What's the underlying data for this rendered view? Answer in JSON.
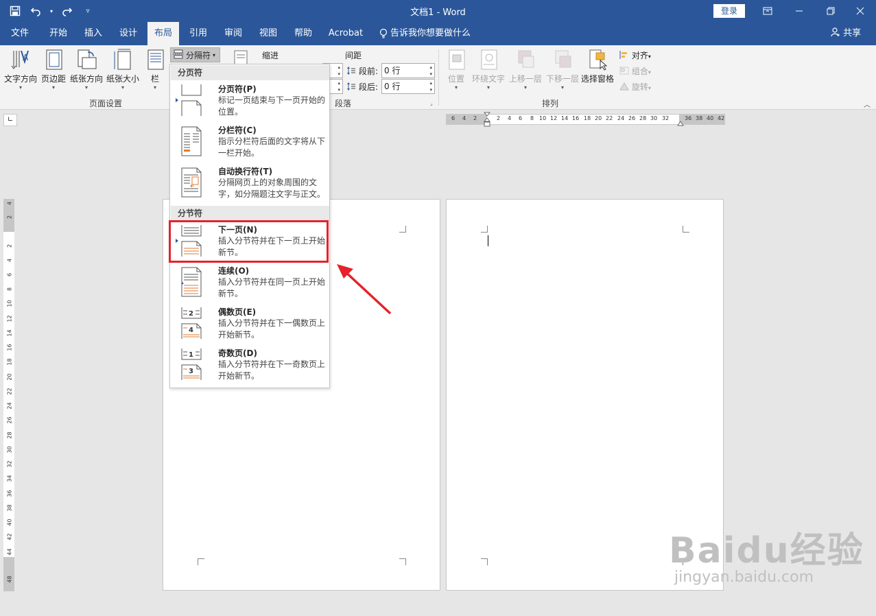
{
  "titlebar": {
    "doc_title": "文档1  -  Word",
    "login": "登录"
  },
  "tabs": [
    {
      "label": "文件"
    },
    {
      "label": "开始"
    },
    {
      "label": "插入"
    },
    {
      "label": "设计"
    },
    {
      "label": "布局"
    },
    {
      "label": "引用"
    },
    {
      "label": "审阅"
    },
    {
      "label": "视图"
    },
    {
      "label": "帮助"
    },
    {
      "label": "Acrobat"
    }
  ],
  "tell_me": "告诉我你想要做什么",
  "share": "共享",
  "ribbon": {
    "page_setup": {
      "text_direction": "文字方向",
      "margins": "页边距",
      "orientation": "纸张方向",
      "size": "纸张大小",
      "columns": "栏",
      "breaks": "分隔符",
      "group_label": "页面设置"
    },
    "paragraph": {
      "indent": "缩进",
      "spacing": "间距",
      "before_label": "段前:",
      "after_label": "段后:",
      "before_value": "0 行",
      "after_value": "0 行",
      "group_label": "段落"
    },
    "arrange": {
      "position": "位置",
      "wrap_text": "环绕文字",
      "bring_forward": "上移一层",
      "send_backward": "下移一层",
      "selection_pane": "选择窗格",
      "align": "对齐",
      "group": "组合",
      "rotate": "旋转",
      "group_label": "排列"
    }
  },
  "ruler": {
    "h_left": [
      "6",
      "4",
      "2"
    ],
    "h_marks": [
      "2",
      "4",
      "6",
      "8",
      "10",
      "12",
      "14",
      "16",
      "18",
      "20",
      "22",
      "24",
      "26",
      "28",
      "30",
      "32"
    ],
    "h_right": [
      "36",
      "38",
      "40",
      "42"
    ],
    "v_top": [
      "4",
      "2"
    ],
    "v_marks": [
      "2",
      "4",
      "6",
      "8",
      "10",
      "12",
      "14",
      "16",
      "18",
      "20",
      "22",
      "24",
      "26",
      "28",
      "30",
      "32",
      "34",
      "36",
      "38",
      "40",
      "42",
      "44"
    ],
    "v_bottom": [
      "48"
    ]
  },
  "menu": {
    "section_page_breaks": "分页符",
    "section_section_breaks": "分节符",
    "items": [
      {
        "title": "分页符(P)",
        "desc": "标记一页结束与下一页开始的位置。"
      },
      {
        "title": "分栏符(C)",
        "desc": "指示分栏符后面的文字将从下一栏开始。"
      },
      {
        "title": "自动换行符(T)",
        "desc": "分隔网页上的对象周围的文字，如分隔题注文字与正文。"
      },
      {
        "title": "下一页(N)",
        "desc": "插入分节符并在下一页上开始新节。"
      },
      {
        "title": "连续(O)",
        "desc": "插入分节符并在同一页上开始新节。"
      },
      {
        "title": "偶数页(E)",
        "desc": "插入分节符并在下一偶数页上开始新节。"
      },
      {
        "title": "奇数页(D)",
        "desc": "插入分节符并在下一奇数页上开始新节。"
      }
    ]
  },
  "watermark": {
    "brand": "Baidu经验",
    "url": "jingyan.baidu.com"
  },
  "colors": {
    "accent": "#2b579a",
    "highlight": "#e4232a"
  }
}
